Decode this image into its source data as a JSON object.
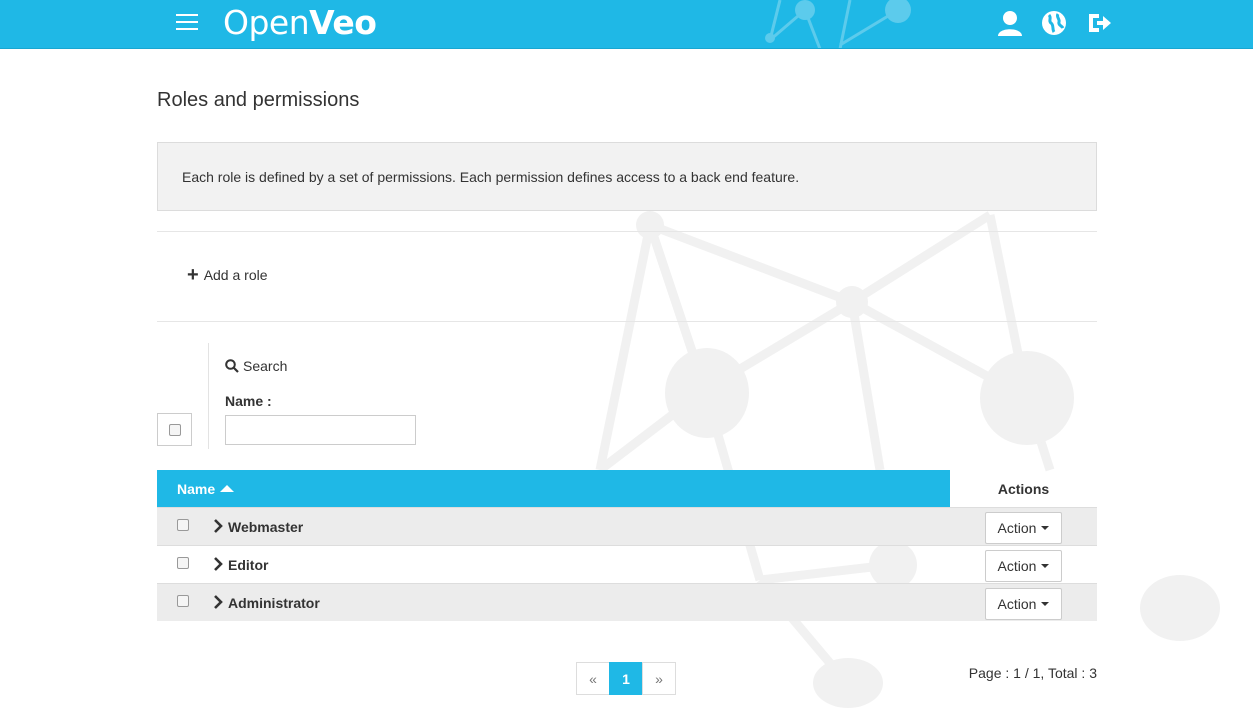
{
  "header": {
    "brand_light": "Open",
    "brand_bold": "Veo",
    "icons": [
      "menu-icon",
      "user-icon",
      "globe-icon",
      "logout-icon"
    ],
    "color": "#1fb8e6"
  },
  "page": {
    "title": "Roles and permissions",
    "info": "Each role is defined by a set of permissions. Each permission defines access to a back end feature.",
    "add_label": "Add a role"
  },
  "search": {
    "label": "Search",
    "name_label": "Name :",
    "name_value": ""
  },
  "table": {
    "columns": [
      "Name",
      "Actions"
    ],
    "rows": [
      {
        "name": "Webmaster",
        "action": "Action"
      },
      {
        "name": "Editor",
        "action": "Action"
      },
      {
        "name": "Administrator",
        "action": "Action"
      }
    ]
  },
  "pagination": {
    "prev": "«",
    "current": "1",
    "next": "»",
    "info_prefix": "Page : ",
    "info_page": "1 / 1",
    "info_total_label": ", Total : ",
    "info_total": "3"
  }
}
